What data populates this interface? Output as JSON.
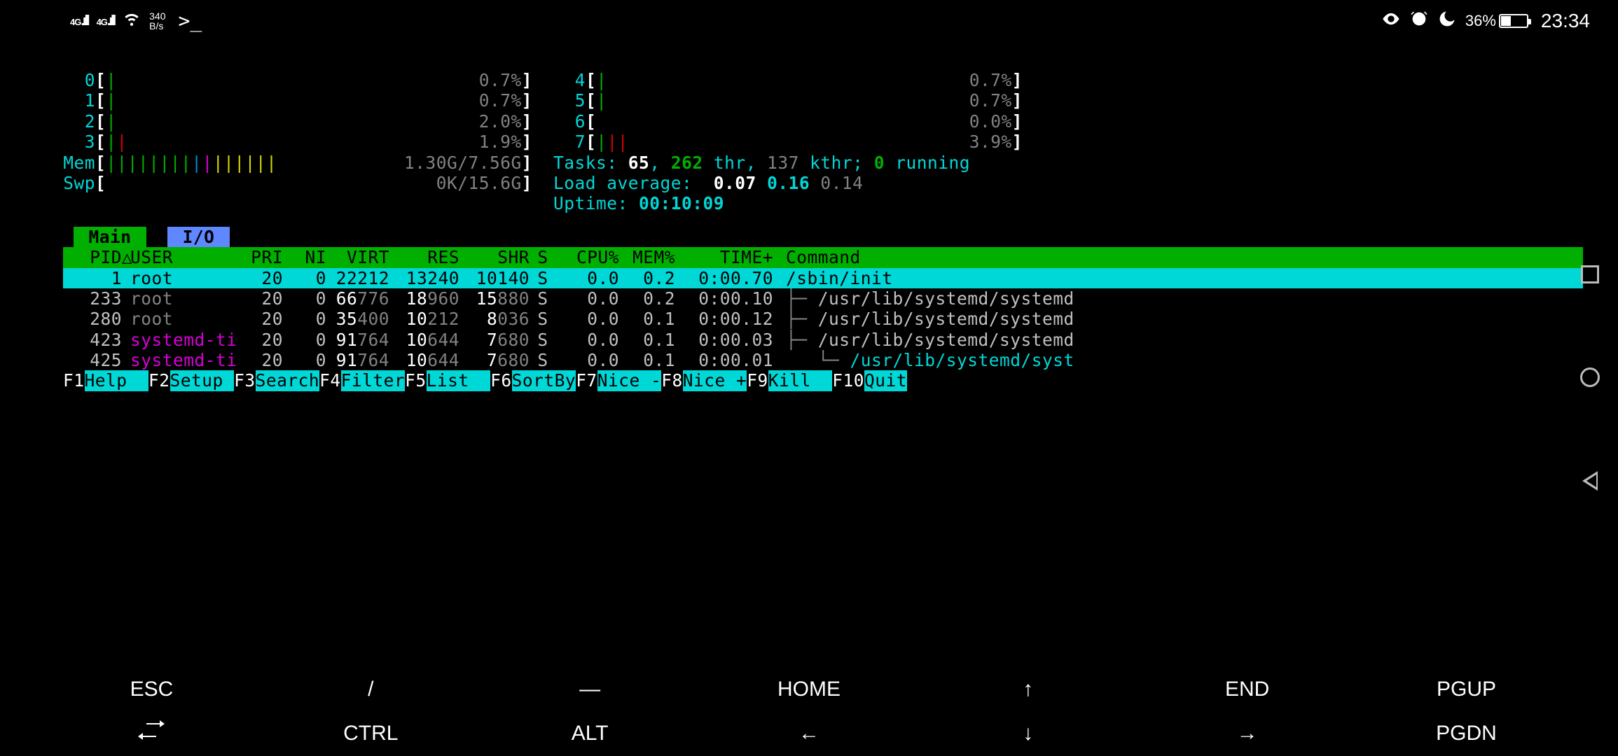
{
  "statusbar": {
    "signal1": "4G",
    "signal2": "4G",
    "rate_top": "340",
    "rate_bottom": "B/s",
    "prompt": ">_",
    "battery_pct": "36%",
    "time": "23:34"
  },
  "cpus": [
    {
      "id": "0",
      "bars": "|",
      "pct": "0.7%"
    },
    {
      "id": "1",
      "bars": "|",
      "pct": "0.7%"
    },
    {
      "id": "2",
      "bars": "|",
      "pct": "2.0%"
    },
    {
      "id": "3",
      "bars": "||",
      "pct": "1.9%"
    },
    {
      "id": "4",
      "bars": "|",
      "pct": "0.7%"
    },
    {
      "id": "5",
      "bars": "|",
      "pct": "0.7%"
    },
    {
      "id": "6",
      "bars": "",
      "pct": "0.0%"
    },
    {
      "id": "7",
      "bars": "|||",
      "pct": "3.9%"
    }
  ],
  "mem": {
    "label": "Mem",
    "used": "1.30G",
    "total": "7.56G"
  },
  "swp": {
    "label": "Swp",
    "used": "0K",
    "total": "15.6G"
  },
  "tasks": {
    "label": "Tasks:",
    "procs": "65",
    "threads": "262",
    "thr_label": "thr,",
    "kthr": "137",
    "kthr_label": "kthr;",
    "running": "0",
    "running_label": "running"
  },
  "load": {
    "label": "Load average:",
    "l1": "0.07",
    "l5": "0.16",
    "l15": "0.14"
  },
  "uptime": {
    "label": "Uptime:",
    "value": "00:10:09"
  },
  "tabs": {
    "main": "Main",
    "io": "I/O"
  },
  "columns": {
    "pid": "PID",
    "user": "USER",
    "pri": "PRI",
    "ni": "NI",
    "virt": "VIRT",
    "res": "RES",
    "shr": "SHR",
    "s": "S",
    "cpu": "CPU%",
    "mem": "MEM%",
    "time": "TIME+",
    "cmd": "Command",
    "sort": "△"
  },
  "processes": [
    {
      "pid": "1",
      "user": "root",
      "pri": "20",
      "ni": "0",
      "virt": "22212",
      "virt_lo": "",
      "res": "13240",
      "res_lo": "",
      "shr": "10140",
      "shr_lo": "",
      "s": "S",
      "cpu": "0.0",
      "mem": "0.2",
      "time": "0:00.70",
      "tree": "",
      "cmd": "/sbin/init",
      "selected": true,
      "user_color": "grey",
      "cmd_color": ""
    },
    {
      "pid": "233",
      "user": "root",
      "pri": "20",
      "ni": "0",
      "virt": "66",
      "virt_lo": "776",
      "res": "18",
      "res_lo": "960",
      "shr": "15",
      "shr_lo": "880",
      "s": "S",
      "cpu": "0.0",
      "mem": "0.2",
      "time": "0:00.10",
      "tree": "├─ ",
      "cmd": "/usr/lib/systemd/systemd",
      "user_color": "grey",
      "cmd_color": ""
    },
    {
      "pid": "280",
      "user": "root",
      "pri": "20",
      "ni": "0",
      "virt": "35",
      "virt_lo": "400",
      "res": "10",
      "res_lo": "212",
      "shr": "8",
      "shr_lo": "036",
      "s": "S",
      "cpu": "0.0",
      "mem": "0.1",
      "time": "0:00.12",
      "tree": "├─ ",
      "cmd": "/usr/lib/systemd/systemd",
      "user_color": "grey",
      "cmd_color": ""
    },
    {
      "pid": "423",
      "user": "systemd-ti",
      "pri": "20",
      "ni": "0",
      "virt": "91",
      "virt_lo": "764",
      "res": "10",
      "res_lo": "644",
      "shr": "7",
      "shr_lo": "680",
      "s": "S",
      "cpu": "0.0",
      "mem": "0.1",
      "time": "0:00.03",
      "tree": "├─ ",
      "cmd": "/usr/lib/systemd/systemd",
      "user_color": "magenta",
      "cmd_color": ""
    },
    {
      "pid": "425",
      "user": "systemd-ti",
      "pri": "20",
      "ni": "0",
      "virt": "91",
      "virt_lo": "764",
      "res": "10",
      "res_lo": "644",
      "shr": "7",
      "shr_lo": "680",
      "s": "S",
      "cpu": "0.0",
      "mem": "0.1",
      "time": "0:00.01",
      "tree": "   └─ ",
      "cmd": "/usr/lib/systemd/syst",
      "user_color": "magenta",
      "cmd_color": "cyan"
    }
  ],
  "fnkeys": [
    {
      "key": "F1",
      "label": "Help  "
    },
    {
      "key": "F2",
      "label": "Setup "
    },
    {
      "key": "F3",
      "label": "Search"
    },
    {
      "key": "F4",
      "label": "Filter"
    },
    {
      "key": "F5",
      "label": "List  "
    },
    {
      "key": "F6",
      "label": "SortBy"
    },
    {
      "key": "F7",
      "label": "Nice -"
    },
    {
      "key": "F8",
      "label": "Nice +"
    },
    {
      "key": "F9",
      "label": "Kill  "
    },
    {
      "key": "F10",
      "label": "Quit"
    }
  ],
  "soft": {
    "row1": [
      "ESC",
      "/",
      "―",
      "HOME",
      "↑",
      "END",
      "PGUP"
    ],
    "row2": [
      "TAB",
      "CTRL",
      "ALT",
      "←",
      "↓",
      "→",
      "PGDN"
    ]
  }
}
